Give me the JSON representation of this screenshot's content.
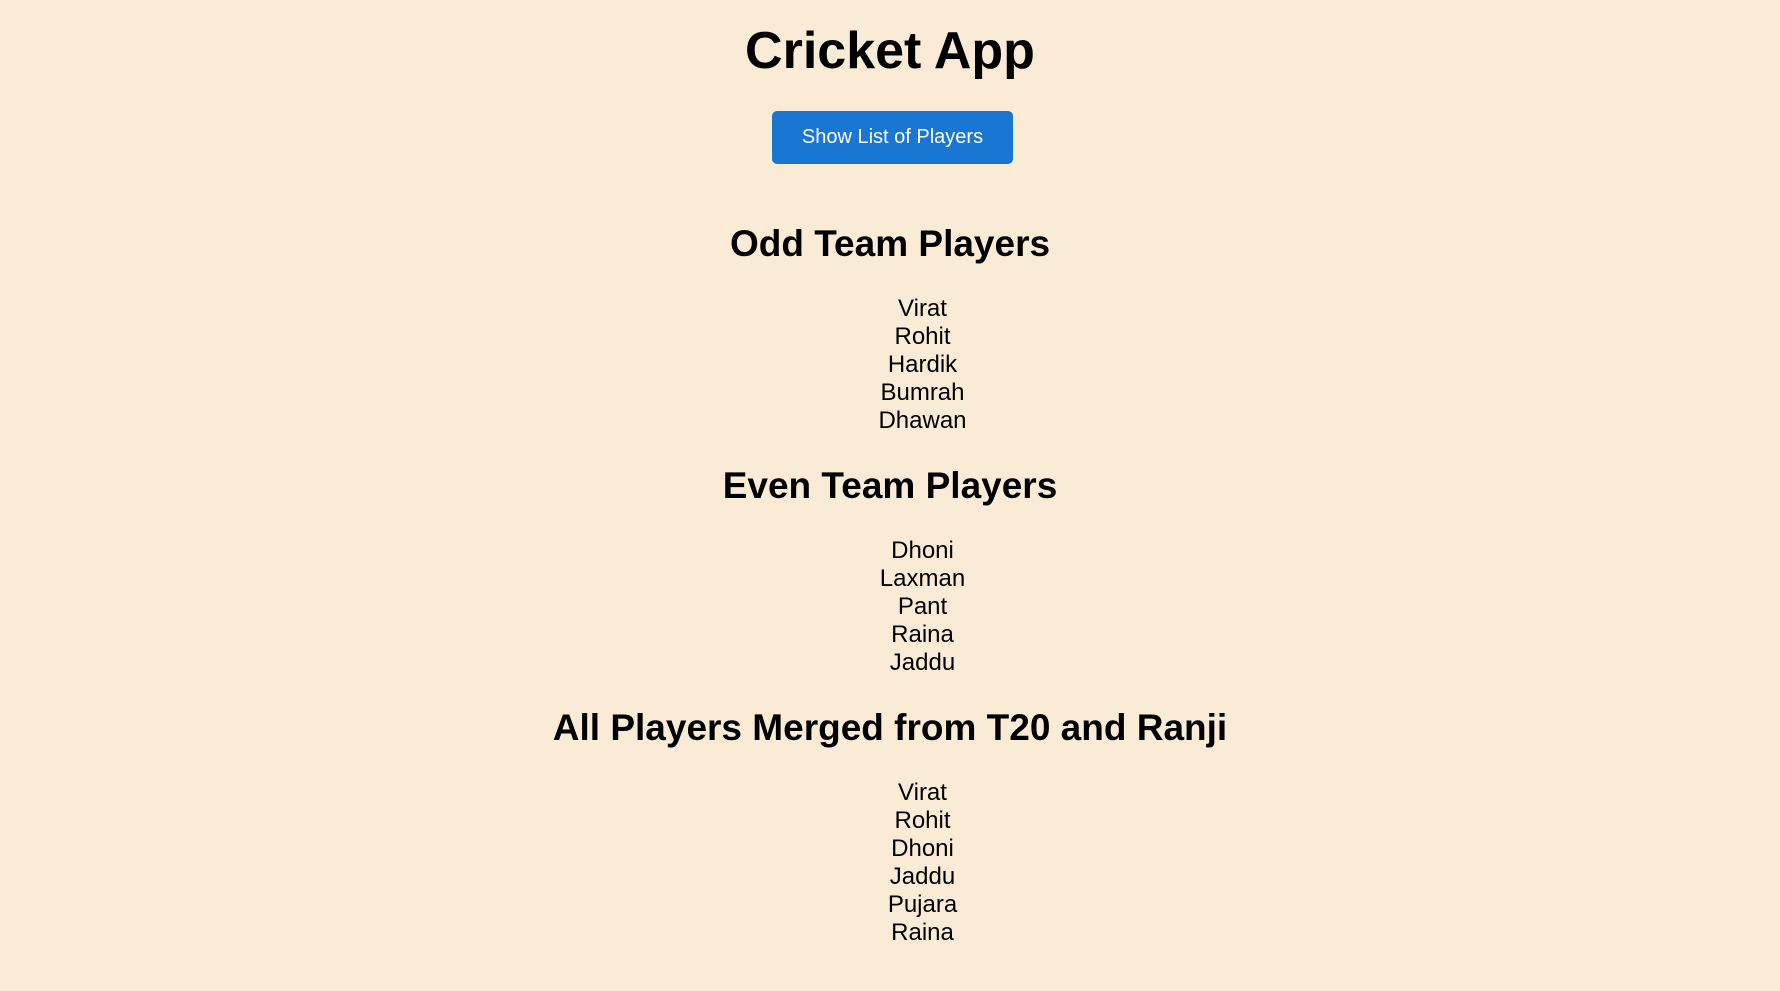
{
  "app": {
    "title": "Cricket App",
    "show_button_label": "Show List of Players",
    "button_color": "#1976d2",
    "background_color": "#faebd7"
  },
  "odd_team": {
    "heading": "Odd Team Players",
    "players": [
      "Virat",
      "Rohit",
      "Hardik",
      "Bumrah",
      "Dhawan"
    ]
  },
  "even_team": {
    "heading": "Even Team Players",
    "players": [
      "Dhoni",
      "Laxman",
      "Pant",
      "Raina",
      "Jaddu"
    ]
  },
  "merged": {
    "heading": "All Players Merged from T20 and Ranji",
    "players": [
      "Virat",
      "Rohit",
      "Dhoni",
      "Jaddu",
      "Pujara",
      "Raina"
    ]
  }
}
